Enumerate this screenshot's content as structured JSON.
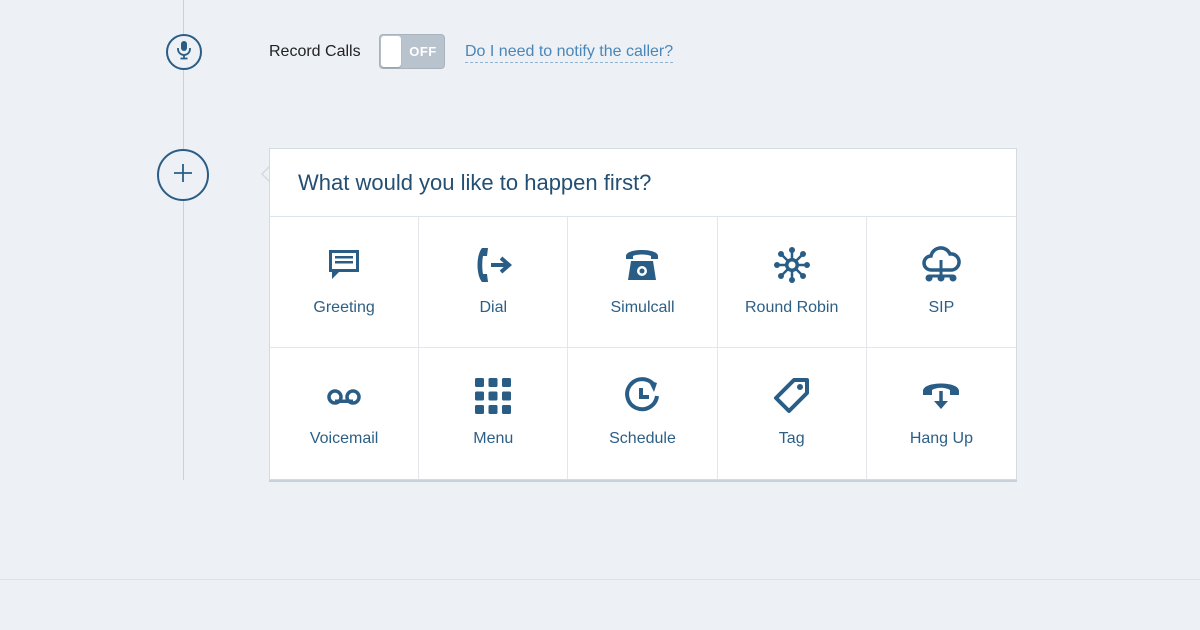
{
  "colors": {
    "accent": "#2a5d86",
    "link": "#4a87b8",
    "toggle_off": "#b9c3cd",
    "background": "#edf0f4"
  },
  "record_calls": {
    "label": "Record Calls",
    "toggle_state": "OFF",
    "help_link": "Do I need to notify the caller?"
  },
  "timeline": {
    "step_icon": "microphone-icon",
    "add_icon": "plus-icon"
  },
  "chooser": {
    "title": "What would you like to happen first?",
    "options": [
      {
        "label": "Greeting",
        "icon": "speech-bubble-icon"
      },
      {
        "label": "Dial",
        "icon": "phone-forward-icon"
      },
      {
        "label": "Simulcall",
        "icon": "desk-phone-icon"
      },
      {
        "label": "Round Robin",
        "icon": "round-robin-icon"
      },
      {
        "label": "SIP",
        "icon": "cloud-network-icon"
      },
      {
        "label": "Voicemail",
        "icon": "voicemail-icon"
      },
      {
        "label": "Menu",
        "icon": "keypad-icon"
      },
      {
        "label": "Schedule",
        "icon": "clock-icon"
      },
      {
        "label": "Tag",
        "icon": "tag-icon"
      },
      {
        "label": "Hang Up",
        "icon": "hang-up-icon"
      }
    ]
  }
}
